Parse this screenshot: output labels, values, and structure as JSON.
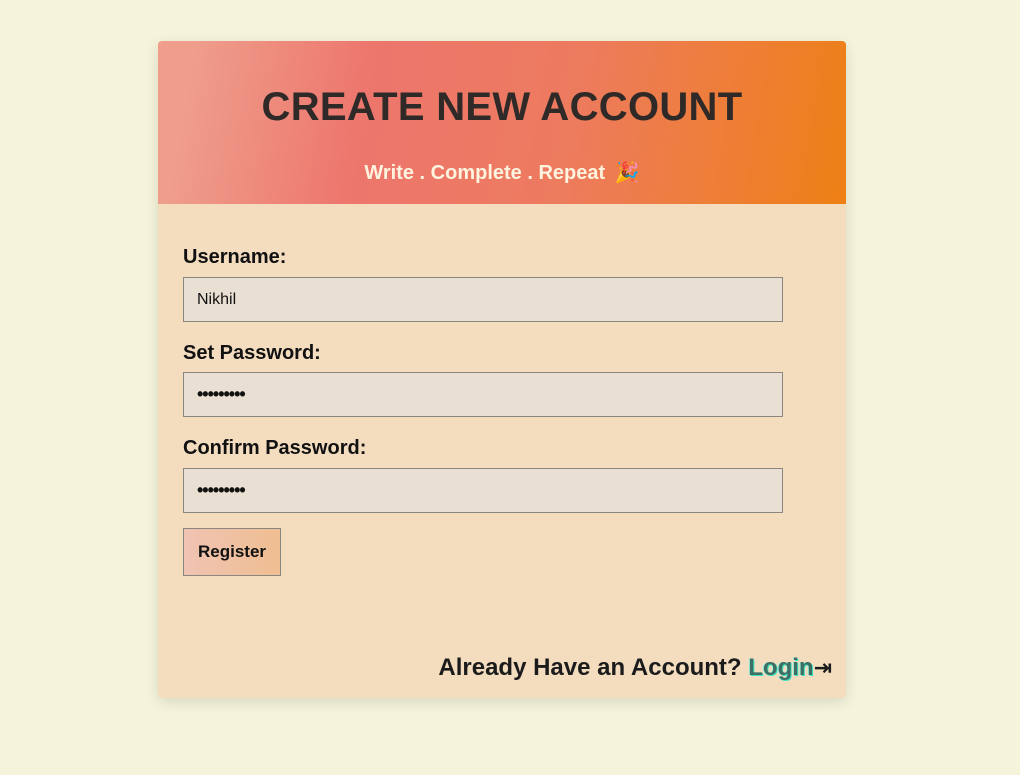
{
  "header": {
    "title": "CREATE NEW ACCOUNT",
    "tagline": "Write . Complete . Repeat",
    "tagline_icon": "🎉"
  },
  "form": {
    "username_label": "Username:",
    "username_value": "Nikhil",
    "password_label": "Set Password:",
    "password_value": "•••••••••",
    "confirm_label": "Confirm Password:",
    "confirm_value": "•••••••••",
    "register_label": "Register"
  },
  "footer": {
    "prompt": "Already Have an Account?",
    "login_label": "Login",
    "login_icon": "⇥"
  },
  "colors": {
    "page_bg": "#f5f4db",
    "card_bg": "#f4dcbf",
    "header_gradient_start": "#ef9e8c",
    "header_gradient_end": "#ee8015",
    "login_accent": "#39e3c2"
  }
}
